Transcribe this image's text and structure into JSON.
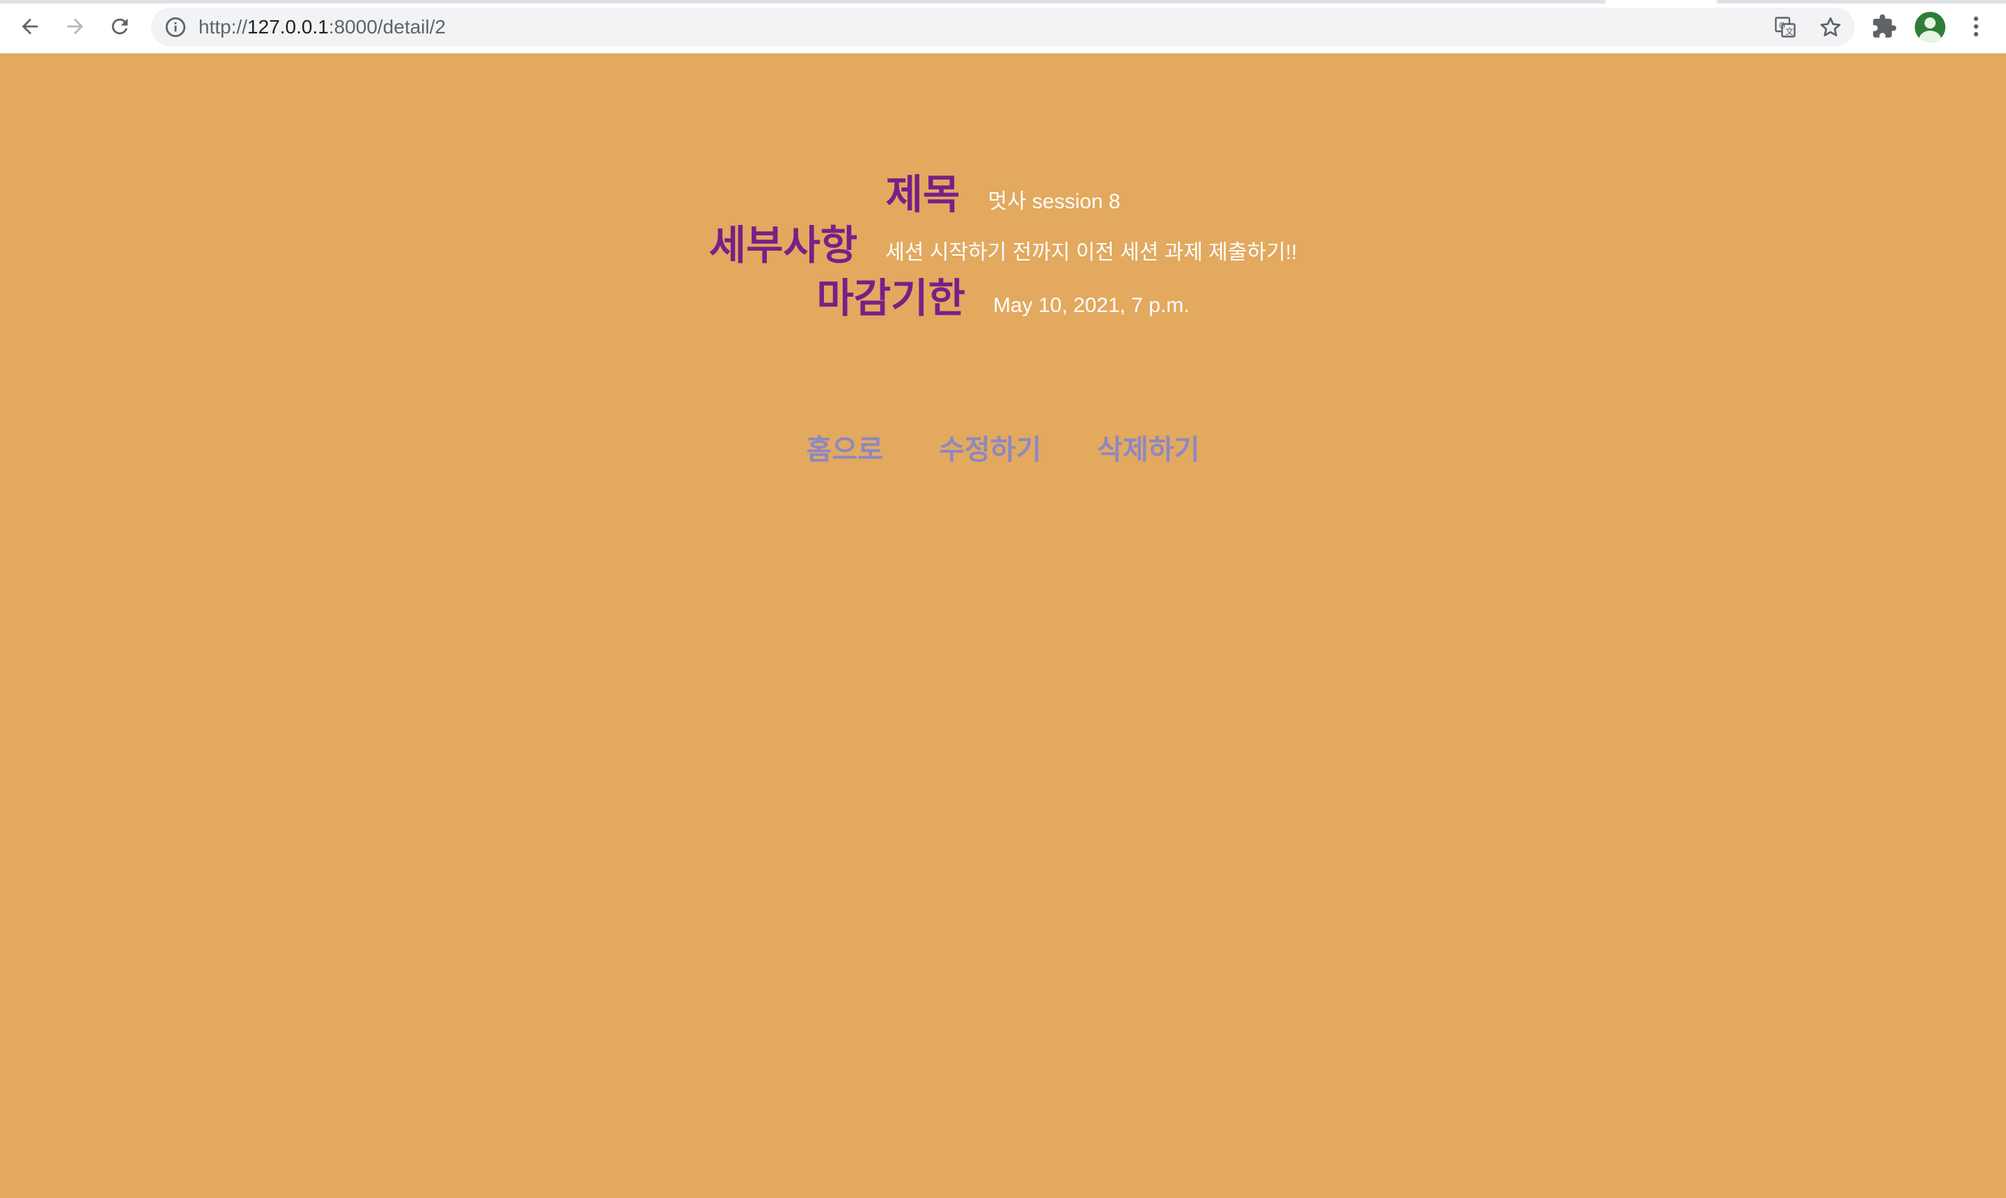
{
  "browser": {
    "url_prefix": "http://",
    "url_host": "127.0.0.1",
    "url_path": ":8000/detail/2",
    "icons": {
      "back": "arrow-left-icon",
      "forward": "arrow-right-icon",
      "reload": "reload-icon",
      "info": "info-icon",
      "translate": "translate-icon",
      "bookmark": "star-icon",
      "extensions": "puzzle-icon",
      "profile": "avatar",
      "menu": "kebab-menu-icon"
    }
  },
  "page": {
    "title_label": "제목",
    "title_value": "멋사 session 8",
    "detail_label": "세부사항",
    "detail_value": "세션 시작하기 전까지 이전 세션 과제 제출하기!!",
    "deadline_label": "마감기한",
    "deadline_value": "May 10, 2021, 7 p.m.",
    "links": {
      "home": "홈으로",
      "edit": "수정하기",
      "delete": "삭제하기"
    }
  },
  "colors": {
    "background": "#e2a95f",
    "label": "#7a1f86",
    "value": "#ffffff",
    "link": "#8c88c3"
  }
}
